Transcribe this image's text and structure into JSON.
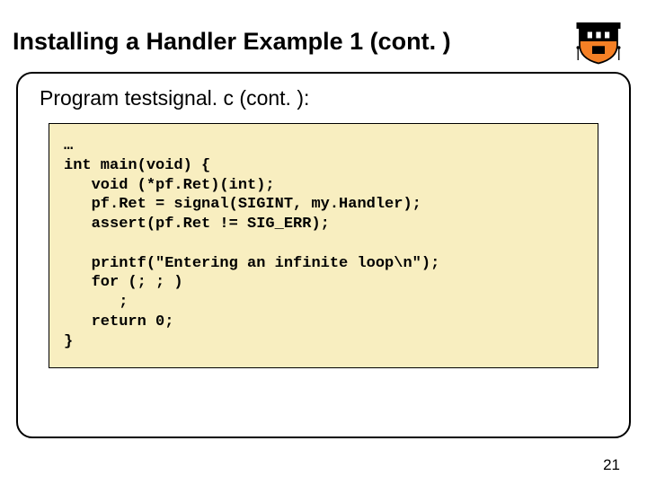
{
  "title": "Installing a Handler Example 1 (cont. )",
  "subtitle": "Program testsignal. c (cont. ):",
  "code": "…\nint main(void) {\n   void (*pf.Ret)(int);\n   pf.Ret = signal(SIGINT, my.Handler);\n   assert(pf.Ret != SIG_ERR);\n\n   printf(\"Entering an infinite loop\\n\");\n   for (; ; )\n      ;\n   return 0;\n}",
  "page_number": "21"
}
